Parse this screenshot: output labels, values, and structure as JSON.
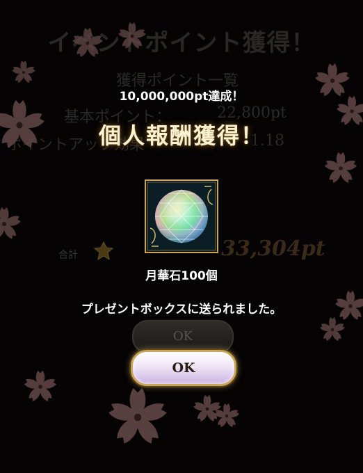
{
  "background_dialog": {
    "title": "イベントポイント獲得！",
    "list_heading": "獲得ポイント一覧",
    "basic_points_label": "基本ポイント：",
    "basic_points_value": "22,800pt",
    "bonus_label": "ポイントアップ効果",
    "bonus_value": "1.18",
    "total_label": "合計",
    "total_value": "33,304pt",
    "ok_label": "OK"
  },
  "reward_popup": {
    "subtitle": "10,000,000pt達成！",
    "title": "個人報酬獲得！",
    "item_name": "月華石100個",
    "item_icon": "rainbow-gem-icon",
    "message": "プレゼントボックスに送られました。",
    "ok_label": "OK"
  },
  "colors": {
    "background": "#050303",
    "flower": "#6b4d4c",
    "title_gold": "#fdf3d2",
    "frame_gold": "#c9a65a"
  }
}
